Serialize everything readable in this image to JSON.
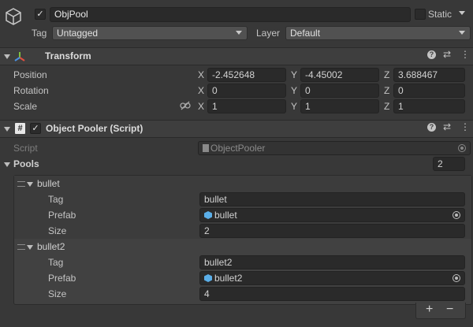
{
  "gameobject": {
    "name": "ObjPool",
    "active": true,
    "static_label": "Static",
    "tag_label": "Tag",
    "tag_value": "Untagged",
    "layer_label": "Layer",
    "layer_value": "Default"
  },
  "transform": {
    "title": "Transform",
    "position_label": "Position",
    "rotation_label": "Rotation",
    "scale_label": "Scale",
    "x_label": "X",
    "y_label": "Y",
    "z_label": "Z",
    "position": {
      "x": "-2.452648",
      "y": "-4.45002",
      "z": "3.688467"
    },
    "rotation": {
      "x": "0",
      "y": "0",
      "z": "0"
    },
    "scale": {
      "x": "1",
      "y": "1",
      "z": "1"
    }
  },
  "script_component": {
    "title": "Object Pooler (Script)",
    "script_label": "Script",
    "script_value": "ObjectPooler",
    "pools_label": "Pools",
    "pools_count": "2",
    "pools": [
      {
        "name": "bullet",
        "tag_label": "Tag",
        "tag": "bullet",
        "prefab_label": "Prefab",
        "prefab": "bullet",
        "size_label": "Size",
        "size": "2"
      },
      {
        "name": "bullet2",
        "tag_label": "Tag",
        "tag": "bullet2",
        "prefab_label": "Prefab",
        "prefab": "bullet2",
        "size_label": "Size",
        "size": "4"
      }
    ],
    "add_label": "+",
    "remove_label": "−"
  }
}
